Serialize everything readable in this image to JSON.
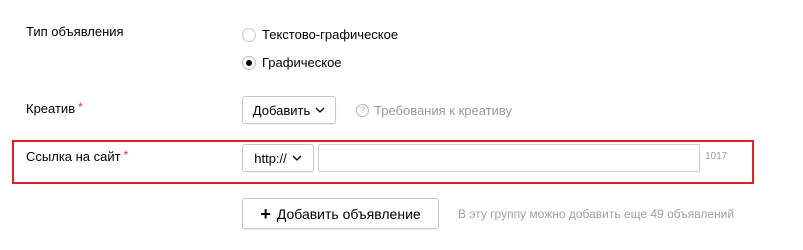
{
  "ad_type": {
    "label": "Тип объявления",
    "options": [
      {
        "label": "Текстово-графическое",
        "selected": false
      },
      {
        "label": "Графическое",
        "selected": true
      }
    ]
  },
  "creative": {
    "label": "Креатив",
    "required_mark": "*",
    "add_button": "Добавить",
    "help_icon": "question-icon",
    "help_text": "Требования к креативу"
  },
  "site_link": {
    "label": "Ссылка на сайт",
    "required_mark": "*",
    "protocol": "http://",
    "url_value": "",
    "url_placeholder": "",
    "char_counter": "1017",
    "highlight_color": "#e0202a"
  },
  "add_ad": {
    "button_icon": "plus-icon",
    "button_label": "Добавить объявление",
    "note": "В эту группу можно добавить еще 49 объявлений"
  }
}
